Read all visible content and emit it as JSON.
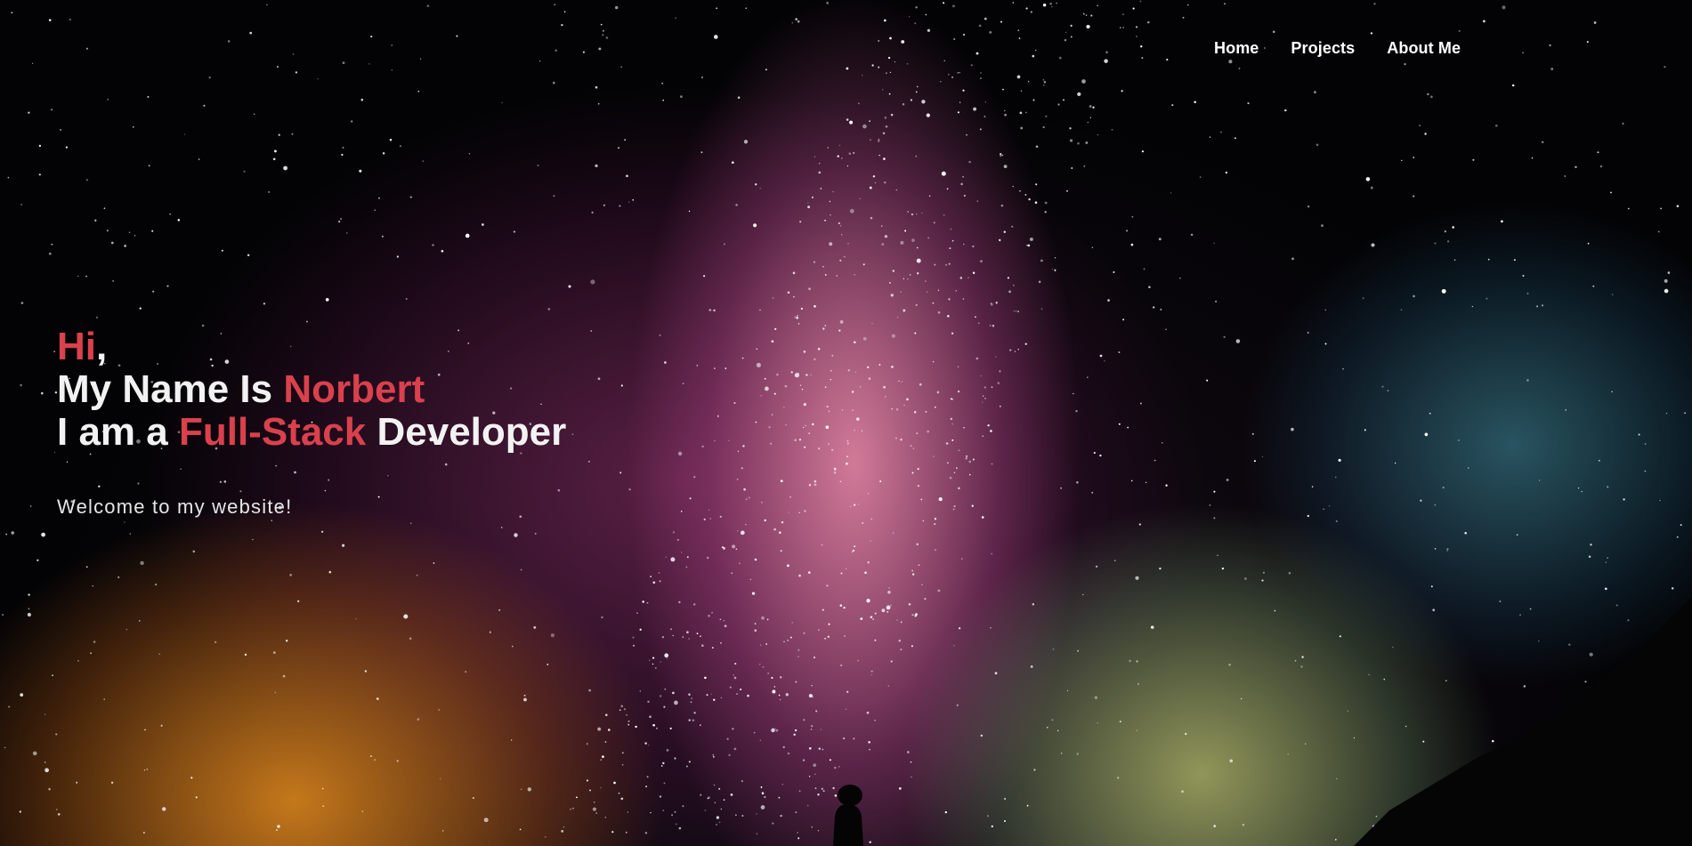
{
  "nav": {
    "items": [
      "Home",
      "Projects",
      "About Me"
    ]
  },
  "hero": {
    "line1": {
      "accent": "Hi",
      "rest": ","
    },
    "line2": {
      "prefix": "My Name Is ",
      "accent": "Norbert"
    },
    "line3": {
      "prefix": "I am a ",
      "accent": "Full-Stack",
      "suffix": " Developer"
    },
    "welcome": "Welcome to my website!"
  },
  "colors": {
    "accent": "#d9414d",
    "text": "#f2f2f2"
  }
}
